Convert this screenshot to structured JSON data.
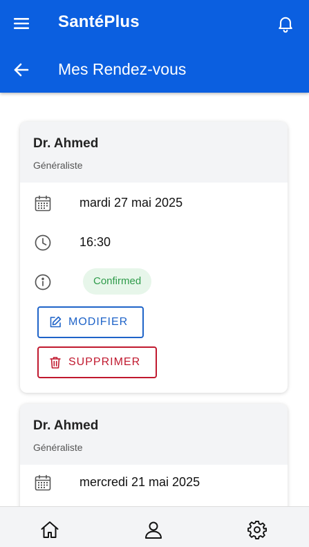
{
  "app": {
    "brand": "SantéPlus"
  },
  "header": {
    "title": "Mes Rendez-vous"
  },
  "appointments": [
    {
      "doctor": "Dr. Ahmed",
      "specialty": "Généraliste",
      "date": "mardi 27 mai 2025",
      "time": "16:30",
      "status": "Confirmed",
      "edit_label": "MODIFIER",
      "delete_label": "SUPPRIMER"
    },
    {
      "doctor": "Dr. Ahmed",
      "specialty": "Généraliste",
      "date": "mercredi 21 mai 2025"
    }
  ],
  "colors": {
    "primary": "#0b5fe0",
    "status_confirmed_bg": "#e7f6ea",
    "status_confirmed_text": "#2e9b4a",
    "edit": "#1e63c8",
    "delete": "#c0182e"
  },
  "icons": {
    "menu": "menu-icon",
    "notifications": "bell-icon",
    "back": "arrow-back-icon",
    "date": "calendar-icon",
    "time": "clock-icon",
    "status": "info-icon",
    "edit": "edit-icon",
    "delete": "trash-icon",
    "home": "home-icon",
    "profile": "user-icon",
    "settings": "settings-icon"
  }
}
